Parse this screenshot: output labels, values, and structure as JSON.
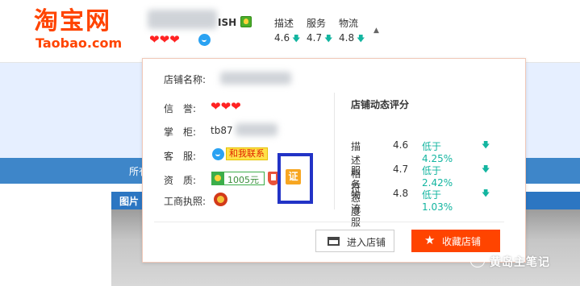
{
  "header": {
    "logo_cn": "淘宝网",
    "logo_en": "Taobao.com",
    "shop_name_suffix": "ISH",
    "credit_hearts": "❤❤❤",
    "ratings": [
      {
        "label": "描述",
        "score": "4.6"
      },
      {
        "label": "服务",
        "score": "4.7"
      },
      {
        "label": "物流",
        "score": "4.8"
      }
    ],
    "caret": "▲"
  },
  "background": {
    "nav_text": "所有",
    "section_title": "图片"
  },
  "popup": {
    "shop_name_label": "店铺名称:",
    "credit_label": "信　誉:",
    "credit_hearts": "❤❤❤",
    "owner_label": "掌　柜:",
    "owner_value": "tb87",
    "service_label": "客　服:",
    "contact_label": "和我联系",
    "qualification_label": "资　质:",
    "deposit_value": "1005元",
    "cert_label": "证",
    "license_label": "工商执照:",
    "dynamic_title": "店铺动态评分",
    "dynamic": [
      {
        "name": "描述相符",
        "score": "4.6",
        "compare": "低于4.25%"
      },
      {
        "name": "服务态度",
        "score": "4.7",
        "compare": "低于2.42%"
      },
      {
        "name": "物流服务",
        "score": "4.8",
        "compare": "低于1.03%"
      }
    ],
    "enter_store": "进入店铺",
    "favorite_store": "收藏店铺"
  },
  "watermark": "黄岛主笔记",
  "colors": {
    "brand": "#ff4400",
    "down": "#13b5a0",
    "highlight": "#2233c6",
    "blue_bar": "#3e86c9"
  }
}
